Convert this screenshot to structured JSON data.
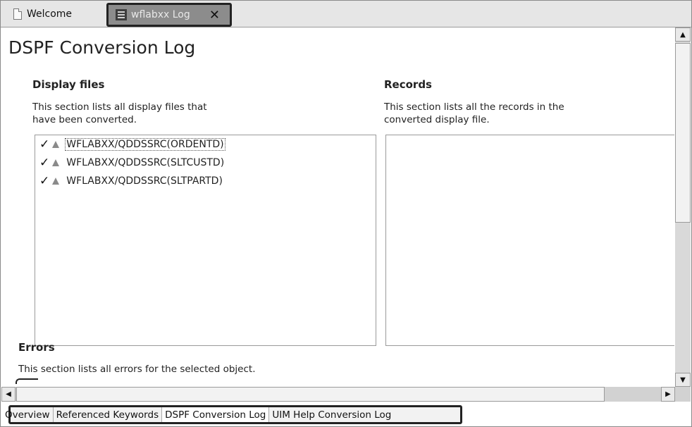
{
  "tabs": {
    "welcome_label": "Welcome",
    "log_label": "wflabxx Log",
    "close_glyph": "✕"
  },
  "page": {
    "title": "DSPF Conversion Log"
  },
  "display_files": {
    "title": "Display files",
    "description": "This section lists all display files that\n have been converted.",
    "items": [
      {
        "label": "WFLABXX/QDDSSRC(ORDENTD)"
      },
      {
        "label": "WFLABXX/QDDSSRC(SLTCUSTD)"
      },
      {
        "label": "WFLABXX/QDDSSRC(SLTPARTD)"
      }
    ]
  },
  "records": {
    "title": "Records",
    "description": "This section lists all the records in the\n converted display file."
  },
  "errors": {
    "title": "Errors",
    "description": "This section lists all errors for the selected object."
  },
  "glyphs": {
    "check": "✓",
    "up": "▲",
    "down": "▼",
    "left": "◀",
    "right": "▶"
  },
  "bottom_tabs": [
    {
      "label": "Overview"
    },
    {
      "label": "Referenced Keywords"
    },
    {
      "label": "DSPF Conversion Log"
    },
    {
      "label": "UIM Help Conversion Log"
    }
  ]
}
